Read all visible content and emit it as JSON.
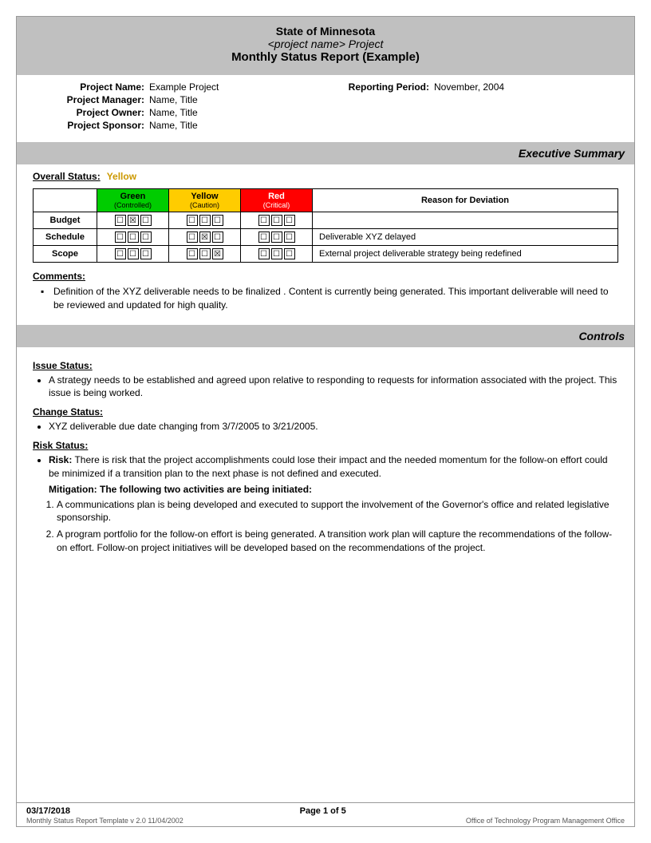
{
  "header": {
    "line1": "State of Minnesota",
    "line2": "<project name> Project",
    "line3": "Monthly Status Report (Example)"
  },
  "project_info": {
    "name_label": "Project Name:",
    "name_value": "Example Project",
    "reporting_period_label": "Reporting Period:",
    "reporting_period_value": "November, 2004",
    "manager_label": "Project Manager:",
    "manager_value": "Name, Title",
    "owner_label": "Project Owner:",
    "owner_value": "Name, Title",
    "sponsor_label": "Project Sponsor:",
    "sponsor_value": "Name, Title"
  },
  "executive_summary": {
    "title": "Executive Summary",
    "overall_status_label": "Overall Status:",
    "overall_status_value": "Yellow",
    "table": {
      "headers": {
        "green": "Green",
        "green_sub": "(Controlled)",
        "yellow": "Yellow",
        "yellow_sub": "(Caution)",
        "red": "Red",
        "red_sub": "(Critical)",
        "reason": "Reason for Deviation"
      },
      "rows": [
        {
          "label": "Budget",
          "green_checks": [
            false,
            true,
            false
          ],
          "yellow_checks": [
            false,
            false,
            false
          ],
          "red_checks": [
            false,
            false,
            false
          ],
          "reason": ""
        },
        {
          "label": "Schedule",
          "green_checks": [
            false,
            false,
            false
          ],
          "yellow_checks": [
            false,
            true,
            false
          ],
          "red_checks": [
            false,
            false,
            false
          ],
          "reason": "Deliverable XYZ delayed"
        },
        {
          "label": "Scope",
          "green_checks": [
            false,
            false,
            false
          ],
          "yellow_checks": [
            false,
            false,
            true
          ],
          "red_checks": [
            false,
            false,
            false
          ],
          "reason": "External project deliverable strategy being redefined"
        }
      ]
    },
    "comments_label": "Comments:",
    "comments": "Definition of the XYZ deliverable  needs to be finalized .  Content is currently being generated.  This important deliverable will need to be reviewed and updated for high quality."
  },
  "controls": {
    "title": "Controls",
    "issue_status_label": "Issue Status:",
    "issue_text": "A strategy needs to be established and agreed upon relative to  responding to  requests for information associated with the project.  This issue is being worked.",
    "change_status_label": "Change Status:",
    "change_text": "XYZ  deliverable due date changing from   3/7/2005 to 3/21/2005.",
    "risk_status_label": "Risk Status:",
    "risk_text": "There is risk that the project accomplishments could lose their impact and the needed momentum for the follow-on effort could be   minimized if a transition plan to the next phase is not defined and executed.",
    "mitigation_label": "Mitigation:",
    "mitigation_intro": "The following two activities are being initiated:",
    "mitigation_items": [
      "A communications plan is being developed and executed to support the involvement of the Governor's office and related legislative sponsorship.",
      "A program portfolio for the follow-on effort is being generated.  A transition work plan will capture the recommendations of the follow-on effort. Follow-on project initiatives will be developed based on the recommendations of the project."
    ]
  },
  "footer": {
    "date": "03/17/2018",
    "page": "Page 1 of 5",
    "template": "Monthly Status Report Template  v 2.0  11/04/2002",
    "office": "Office of Technology Program Management Office"
  }
}
